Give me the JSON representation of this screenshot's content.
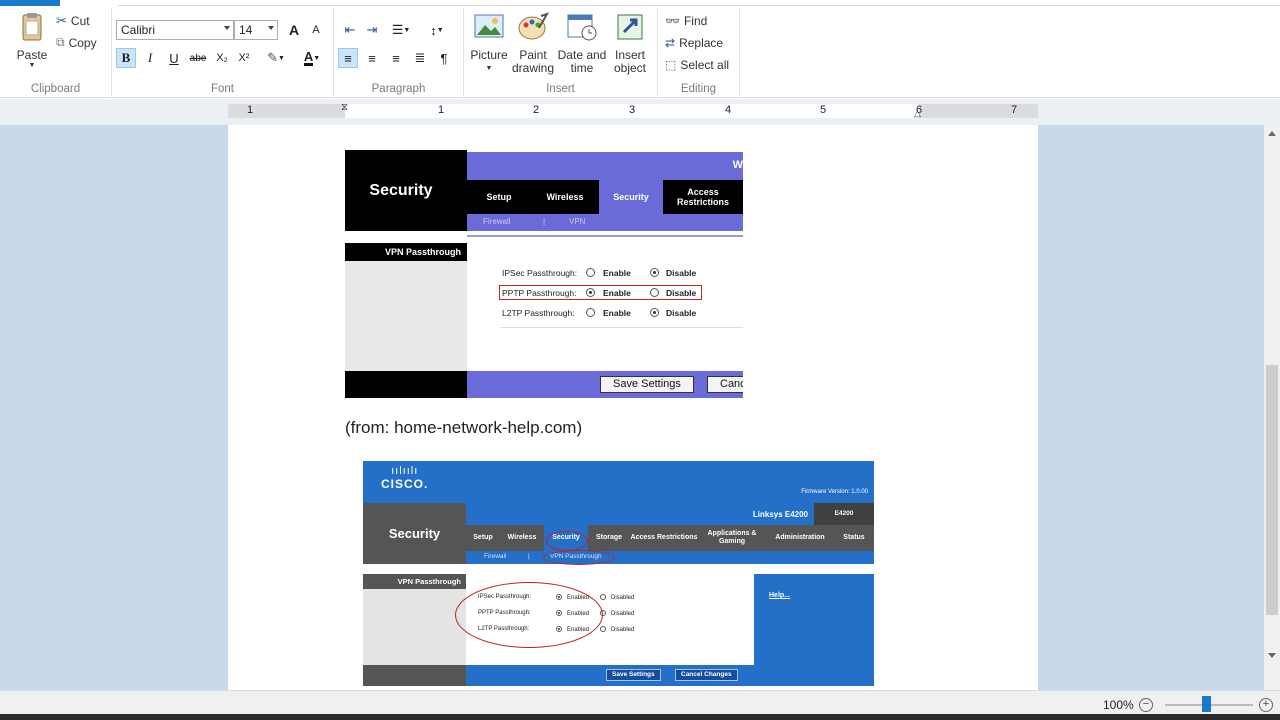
{
  "ribbon": {
    "clipboard": {
      "paste": "Paste",
      "cut": "Cut",
      "copy": "Copy",
      "label": "Clipboard"
    },
    "font": {
      "family": "Calibri",
      "size": "14",
      "label": "Font",
      "bold": "B",
      "italic": "I",
      "underline": "U",
      "strike": "abe",
      "subscript": "X₂",
      "superscript": "X²",
      "grow": "A",
      "shrink": "A"
    },
    "paragraph": {
      "label": "Paragraph"
    },
    "insert": {
      "picture": "Picture",
      "paint_drawing": "Paint drawing",
      "date_time": "Date and time",
      "insert_object": "Insert object",
      "label": "Insert"
    },
    "editing": {
      "find": "Find",
      "replace": "Replace",
      "select_all": "Select all",
      "label": "Editing"
    }
  },
  "ruler": {
    "marks": [
      "1",
      "1",
      "2",
      "3",
      "4",
      "5",
      "6",
      "7"
    ]
  },
  "document": {
    "shot1": {
      "title": "Security",
      "corner_letter": "W",
      "tabs": [
        "Setup",
        "Wireless",
        "Security",
        "Access Restrictions"
      ],
      "subtabs": [
        "Firewall",
        "|",
        "VPN"
      ],
      "section": "VPN Passthrough",
      "rows": [
        {
          "label": "IPSec Passthrough:",
          "enable": "Enable",
          "disable": "Disable"
        },
        {
          "label": "PPTP Passthrough:",
          "enable": "Enable",
          "disable": "Disable"
        },
        {
          "label": "L2TP Passthrough:",
          "enable": "Enable",
          "disable": "Disable"
        }
      ],
      "save": "Save Settings",
      "cancel": "Canc"
    },
    "caption": "(from: home-network-help.com)",
    "shot2": {
      "logo_bars": "ıılıılı",
      "logo_name": "CISCO.",
      "firmware": "Firmware Version: 1.0.00",
      "model_name": "Linksys E4200",
      "model_code": "E4200",
      "title": "Security",
      "tabs": [
        "Setup",
        "Wireless",
        "Security",
        "Storage",
        "Access Restrictions",
        "Applications & Gaming",
        "Administration",
        "Status"
      ],
      "subtabs": [
        "Firewall",
        "|",
        "VPN Passthrough"
      ],
      "section": "VPN Passthrough",
      "help": "Help...",
      "rows": [
        {
          "label": "IPSec Passthrough:",
          "enable": "Enabled",
          "disable": "Disabled"
        },
        {
          "label": "PPTP Passthrough:",
          "enable": "Enabled",
          "disable": "Disabled"
        },
        {
          "label": "L2TP Passthrough:",
          "enable": "Enabled",
          "disable": "Disabled"
        }
      ],
      "save": "Save Settings",
      "cancel": "Cancel Changes"
    }
  },
  "status": {
    "zoom": "100%",
    "zoom_out": "−",
    "zoom_in": "+"
  },
  "colors": {
    "accent": "#1979ca",
    "linksys_purple": "#6a6ad8",
    "cisco_blue": "#2470c8",
    "highlight_red": "#d02020"
  }
}
